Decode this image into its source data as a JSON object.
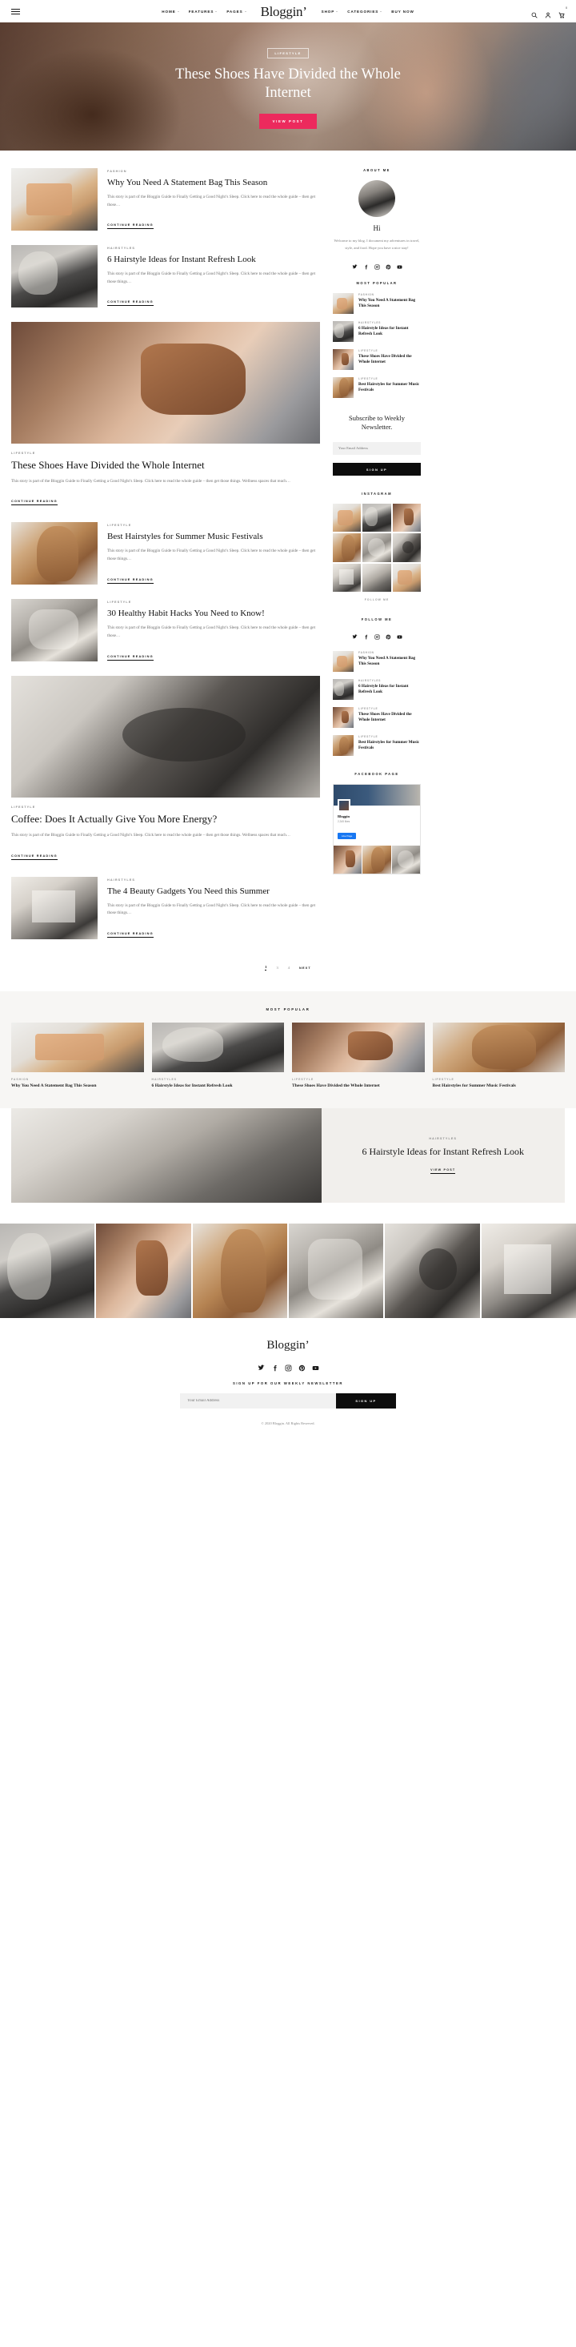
{
  "header": {
    "brand": "Bloggin’",
    "menu": [
      {
        "label": "HOME",
        "caret": true
      },
      {
        "label": "FEATURES",
        "caret": true
      },
      {
        "label": "PAGES",
        "caret": true
      },
      {
        "label": "SHOP",
        "caret": true
      },
      {
        "label": "CATEGORIES",
        "caret": true
      },
      {
        "label": "BUY NOW",
        "caret": false
      }
    ],
    "cart_count": "0"
  },
  "hero": {
    "category": "LIFESTYLE",
    "title": "These Shoes Have Divided the Whole Internet",
    "button": "VIEW POST",
    "button_color": "#ec2a5d"
  },
  "posts": [
    {
      "layout": "row",
      "image": "im-bag",
      "category": "FASHION",
      "title": "Why You Need A Statement Bag This Season",
      "excerpt": "This story is part of the Bloggin Guide to Finally Getting a Good Night’s Sleep. Click here to read the whole guide – then get those…",
      "read_more": "CONTINUE READING"
    },
    {
      "layout": "row",
      "image": "im-sofa",
      "category": "HAIRSTYLES",
      "title": "6 Hairstyle Ideas for Instant Refresh Look",
      "excerpt": "This story is part of the Bloggin Guide to Finally Getting a Good Night’s Sleep. Click here to read the whole guide – then get those things…",
      "read_more": "CONTINUE READING"
    },
    {
      "layout": "wide",
      "image": "im-shoes",
      "category": "LIFESTYLE",
      "title": "These Shoes Have Divided the Whole Internet",
      "excerpt": "This story is part of the Bloggin Guide to Finally Getting a Good Night’s Sleep. Click here to read the whole guide – then get those things. Wellness spaces that reach…",
      "read_more": "CONTINUE READING"
    },
    {
      "layout": "row",
      "image": "im-hair",
      "category": "LIFESTYLE",
      "title": "Best Hairstyles for Summer Music Festivals",
      "excerpt": "This story is part of the Bloggin Guide to Finally Getting a Good Night’s Sleep. Click here to read the whole guide – then get those things…",
      "read_more": "CONTINUE READING"
    },
    {
      "layout": "row",
      "image": "im-knit",
      "category": "LIFESTYLE",
      "title": "30 Healthy Habit Hacks You Need to Know!",
      "excerpt": "This story is part of the Bloggin Guide to Finally Getting a Good Night’s Sleep. Click here to read the whole guide – then get those…",
      "read_more": "CONTINUE READING"
    },
    {
      "layout": "wide",
      "image": "im-glass",
      "category": "LIFESTYLE",
      "title": "Coffee: Does It Actually Give You More Energy?",
      "excerpt": "This story is part of the Bloggin Guide to Finally Getting a Good Night’s Sleep. Click here to read the whole guide – then get those things. Wellness spaces that reach…",
      "read_more": "CONTINUE READING"
    },
    {
      "layout": "row",
      "image": "im-book",
      "category": "HAIRSTYLES",
      "title": "The 4 Beauty Gadgets You Need this Summer",
      "excerpt": "This story is part of the Bloggin Guide to Finally Getting a Good Night’s Sleep. Click here to read the whole guide – then get those things…",
      "read_more": "CONTINUE READING"
    }
  ],
  "pagination": {
    "pages": [
      "1",
      "3",
      "4"
    ],
    "current": "1",
    "next": "NEXT"
  },
  "sidebar": {
    "about": {
      "title": "ABOUT ME",
      "greeting": "Hi",
      "text": "Welcome to my blog. I document my adventures in travel, style, and food. Hope you have a nice stay!",
      "socials": [
        "twitter-icon",
        "facebook-icon",
        "instagram-icon",
        "pinterest-icon",
        "youtube-icon"
      ]
    },
    "most_popular": {
      "title": "MOST POPULAR",
      "items": [
        {
          "image": "im-bag",
          "category": "FASHION",
          "title": "Why You Need A Statement Bag This Season"
        },
        {
          "image": "im-sofa",
          "category": "HAIRSTYLES",
          "title": "6 Hairstyle Ideas for Instant Refresh Look"
        },
        {
          "image": "im-shoes",
          "category": "LIFESTYLE",
          "title": "These Shoes Have Divided the Whole Internet"
        },
        {
          "image": "im-hair",
          "category": "LIFESTYLE",
          "title": "Best Hairstyles for Summer Music Festivals"
        }
      ]
    },
    "newsletter": {
      "title": "Subscribe to Weekly Newsletter.",
      "placeholder": "Your Email Address",
      "button": "SIGN UP"
    },
    "instagram": {
      "title": "INSTAGRAM",
      "follow": "FOLLOW ME",
      "cell_count": 9
    },
    "follow": {
      "title": "FOLLOW ME",
      "socials": [
        "twitter-icon",
        "facebook-icon",
        "instagram-icon",
        "pinterest-icon",
        "youtube-icon"
      ]
    },
    "facebook": {
      "title": "FACEBOOK PAGE",
      "page_name": "Bloggin",
      "sub": "2,345 likes",
      "like_button": "Like Page"
    }
  },
  "most_popular_strip": {
    "title": "MOST POPULAR",
    "items": [
      {
        "image": "im-bag",
        "category": "FASHION",
        "title": "Why You Need A Statement Bag This Season"
      },
      {
        "image": "im-sofa",
        "category": "HAIRSTYLES",
        "title": "6 Hairstyle Ideas for Instant Refresh Look"
      },
      {
        "image": "im-shoes",
        "category": "LIFESTYLE",
        "title": "These Shoes Have Divided the Whole Internet"
      },
      {
        "image": "im-hair",
        "category": "LIFESTYLE",
        "title": "Best Hairstyles for Summer Music Festivals"
      }
    ]
  },
  "feature_banner": {
    "image": "im-fur",
    "category": "HAIRSTYLES",
    "title": "6 Hairstyle Ideas for Instant Refresh Look",
    "button": "VIEW POST"
  },
  "instagram_strip": {
    "cell_count": 6
  },
  "footer": {
    "brand": "Bloggin’",
    "socials": [
      "twitter-icon",
      "facebook-icon",
      "instagram-icon",
      "pinterest-icon",
      "youtube-icon"
    ],
    "newsletter_title": "SIGN UP FOR OUR WEEKLY NEWSLETTER",
    "placeholder": "Your Email Address",
    "button": "SIGN UP",
    "copyright": "© 2020 Bloggin. All Rights Reserved."
  }
}
